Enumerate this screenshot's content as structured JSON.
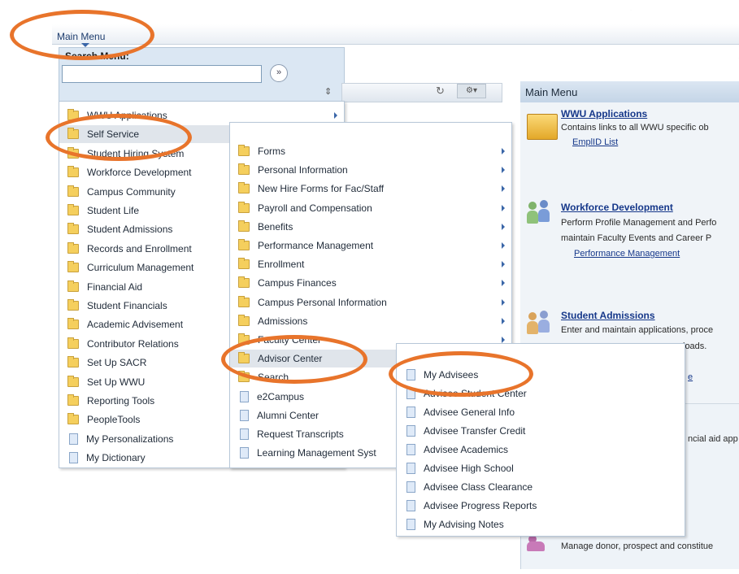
{
  "header": {
    "main_menu_label": "Main Menu"
  },
  "search": {
    "label": "Search Menu:",
    "value": "",
    "go_glyph": "»",
    "sort_glyph": "⇕"
  },
  "toolbar": {
    "refresh_glyph": "↻",
    "settings_glyph": "⚙▾"
  },
  "menu1": {
    "items": [
      {
        "label": "WWU Applications",
        "icon": "folder-icon",
        "arrow": true
      },
      {
        "label": "Self Service",
        "icon": "folder-icon",
        "arrow": false,
        "selected": true
      },
      {
        "label": "Student Hiring System",
        "icon": "folder-icon"
      },
      {
        "label": "Workforce Development",
        "icon": "folder-icon"
      },
      {
        "label": "Campus Community",
        "icon": "folder-icon"
      },
      {
        "label": "Student Life",
        "icon": "folder-icon"
      },
      {
        "label": "Student Admissions",
        "icon": "folder-icon"
      },
      {
        "label": "Records and Enrollment",
        "icon": "folder-icon"
      },
      {
        "label": "Curriculum Management",
        "icon": "folder-icon"
      },
      {
        "label": "Financial Aid",
        "icon": "folder-icon"
      },
      {
        "label": "Student Financials",
        "icon": "folder-icon"
      },
      {
        "label": "Academic Advisement",
        "icon": "folder-icon"
      },
      {
        "label": "Contributor Relations",
        "icon": "folder-icon"
      },
      {
        "label": "Set Up SACR",
        "icon": "folder-icon"
      },
      {
        "label": "Set Up WWU",
        "icon": "folder-icon"
      },
      {
        "label": "Reporting Tools",
        "icon": "folder-icon"
      },
      {
        "label": "PeopleTools",
        "icon": "folder-icon"
      },
      {
        "label": "My Personalizations",
        "icon": "document-icon"
      },
      {
        "label": "My Dictionary",
        "icon": "document-icon"
      }
    ]
  },
  "menu2": {
    "items": [
      {
        "label": "Forms",
        "icon": "folder-icon",
        "arrow": true
      },
      {
        "label": "Personal Information",
        "icon": "folder-icon",
        "arrow": true
      },
      {
        "label": "New Hire Forms for Fac/Staff",
        "icon": "folder-icon",
        "arrow": true
      },
      {
        "label": "Payroll and Compensation",
        "icon": "folder-icon",
        "arrow": true
      },
      {
        "label": "Benefits",
        "icon": "folder-icon",
        "arrow": true
      },
      {
        "label": "Performance Management",
        "icon": "folder-icon",
        "arrow": true
      },
      {
        "label": "Enrollment",
        "icon": "folder-icon",
        "arrow": true
      },
      {
        "label": "Campus Finances",
        "icon": "folder-icon",
        "arrow": true
      },
      {
        "label": "Campus Personal Information",
        "icon": "folder-icon",
        "arrow": true
      },
      {
        "label": "Admissions",
        "icon": "folder-icon",
        "arrow": true
      },
      {
        "label": "Faculty Center",
        "icon": "folder-icon",
        "arrow": true
      },
      {
        "label": "Advisor Center",
        "icon": "folder-icon",
        "arrow": false,
        "selected": true
      },
      {
        "label": "Search",
        "icon": "folder-icon"
      },
      {
        "label": "e2Campus",
        "icon": "document-icon"
      },
      {
        "label": "Alumni Center",
        "icon": "document-icon"
      },
      {
        "label": "Request Transcripts",
        "icon": "document-icon"
      },
      {
        "label": "Learning Management Syst",
        "icon": "document-icon"
      }
    ]
  },
  "menu3": {
    "items": [
      {
        "label": "My Advisees",
        "icon": "document-icon"
      },
      {
        "label": "Advisee Student Center",
        "icon": "document-icon"
      },
      {
        "label": "Advisee General Info",
        "icon": "document-icon"
      },
      {
        "label": "Advisee Transfer Credit",
        "icon": "document-icon"
      },
      {
        "label": "Advisee Academics",
        "icon": "document-icon"
      },
      {
        "label": "Advisee High School",
        "icon": "document-icon"
      },
      {
        "label": "Advisee Class Clearance",
        "icon": "document-icon"
      },
      {
        "label": "Advisee Progress Reports",
        "icon": "document-icon"
      },
      {
        "label": "My Advising Notes",
        "icon": "document-icon"
      }
    ]
  },
  "right_panel": {
    "title": "Main Menu",
    "cards": [
      {
        "link": "WWU Applications",
        "desc": "Contains links to all WWU specific ob",
        "sub": "EmplID List"
      },
      {
        "link": "Workforce Development",
        "desc": "Perform Profile Management and Perfo",
        "desc2": "maintain Faculty Events and Career P",
        "sub": "Performance Management"
      },
      {
        "link": "Student Admissions",
        "desc": "Enter and maintain applications, proce",
        "desc2": "loads.",
        "sub": "e"
      },
      {
        "desc": "ncial aid app"
      },
      {
        "desc": "Manage donor, prospect and constitue"
      }
    ]
  },
  "colors": {
    "highlight_ring": "#e8742b",
    "link": "#16388a",
    "menu_bg": "#dbe7f3"
  }
}
